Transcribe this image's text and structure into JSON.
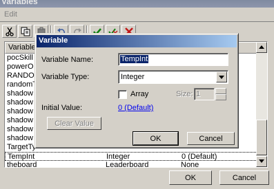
{
  "window": {
    "title": "Variables"
  },
  "menu": {
    "edit": "Edit"
  },
  "list": {
    "columns": [
      "Variable",
      "",
      ""
    ],
    "rows": [
      {
        "name": "pocSkill",
        "type": "",
        "value": ""
      },
      {
        "name": "powerO",
        "type": "",
        "value": ""
      },
      {
        "name": "RANDO",
        "type": "",
        "value": ""
      },
      {
        "name": "randomT",
        "type": "",
        "value": ""
      },
      {
        "name": "shadow",
        "type": "",
        "value": ""
      },
      {
        "name": "shadow",
        "type": "",
        "value": ""
      },
      {
        "name": "shadow",
        "type": "",
        "value": ""
      },
      {
        "name": "shadow",
        "type": "",
        "value": ""
      },
      {
        "name": "shadow",
        "type": "",
        "value": ""
      },
      {
        "name": "shadow",
        "type": "",
        "value": ""
      },
      {
        "name": "TargetTy",
        "type": "",
        "value": ""
      },
      {
        "name": "TempInt",
        "type": "Integer",
        "value": "0 (Default)"
      },
      {
        "name": "theboard",
        "type": "Leaderboard",
        "value": "None"
      }
    ]
  },
  "main_buttons": {
    "ok": "OK",
    "cancel": "Cancel"
  },
  "dialog": {
    "title": "Variable",
    "name_label": "Variable Name:",
    "name_value": "TempInt",
    "type_label": "Variable Type:",
    "type_value": "Integer",
    "array_label": "Array",
    "size_label": "Size:",
    "size_value": "1",
    "initial_label": "Initial Value:",
    "initial_value": "0 (Default)",
    "clear_button": "Clear Value",
    "ok": "OK",
    "cancel": "Cancel"
  },
  "colors": {
    "dialog_title": "#0a246a",
    "selection": "#0a246a",
    "link": "#0000ee"
  },
  "icons": [
    "cut-icon",
    "copy-icon",
    "paste-icon",
    "undo-icon",
    "redo-icon",
    "check-icon",
    "check-all-icon",
    "delete-icon"
  ]
}
